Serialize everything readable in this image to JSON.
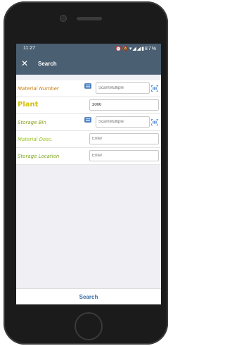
{
  "status_bar": {
    "time": "11:27",
    "battery": "87%"
  },
  "header": {
    "title": "Search",
    "close_icon": "close-icon"
  },
  "form": {
    "material_number": {
      "label": "Material Number",
      "placeholder": "Scan\\Multiple",
      "value": ""
    },
    "plant": {
      "label": "Plant",
      "value": "3000"
    },
    "storage_bin": {
      "label": "Storage Bin",
      "placeholder": "Scan\\Multiple",
      "value": ""
    },
    "material_desc": {
      "label": "Material Desc.",
      "placeholder": "Enter",
      "value": ""
    },
    "storage_location": {
      "label": "Storage Location",
      "placeholder": "Enter",
      "value": ""
    }
  },
  "footer": {
    "search_label": "Search"
  },
  "colors": {
    "header_bg": "#4a5f71",
    "accent_link": "#3a6ea5",
    "label_orange": "#c97d10",
    "label_plant": "#d4c10e",
    "label_green": "#9bc41f"
  }
}
